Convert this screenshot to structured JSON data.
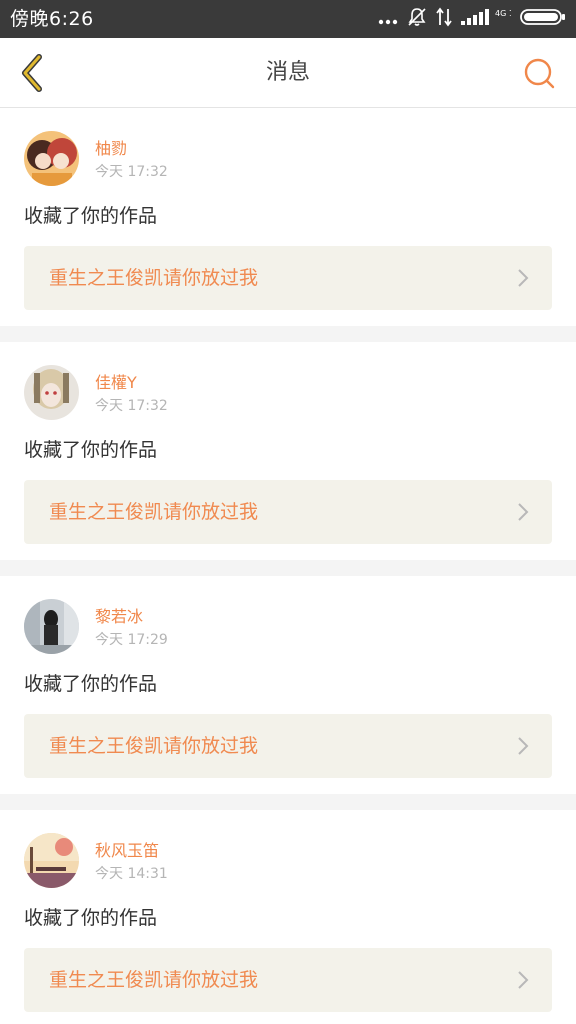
{
  "status_bar": {
    "time": "傍晚6:26",
    "network_label": "4G 1X",
    "icons": [
      "more-dots-icon",
      "mute-bell-icon",
      "data-arrows-icon",
      "signal-icon",
      "battery-icon"
    ]
  },
  "nav": {
    "title": "消息",
    "back_icon": "chevron-left-icon",
    "search_icon": "search-icon"
  },
  "colors": {
    "accent": "#f0874a",
    "back_icon": "#e0b92f",
    "card_link_bg": "#f3f2ea",
    "page_bg": "#f4f4f4"
  },
  "messages": [
    {
      "user": "柚勠",
      "time": "今天 17:32",
      "action": "收藏了你的作品",
      "work_title": "重生之王俊凯请你放过我"
    },
    {
      "user": "佳權Y",
      "time": "今天 17:32",
      "action": "收藏了你的作品",
      "work_title": "重生之王俊凯请你放过我"
    },
    {
      "user": "黎若冰",
      "time": "今天 17:29",
      "action": "收藏了你的作品",
      "work_title": "重生之王俊凯请你放过我"
    },
    {
      "user": "秋风玉笛",
      "time": "今天 14:31",
      "action": "收藏了你的作品",
      "work_title": "重生之王俊凯请你放过我"
    }
  ]
}
